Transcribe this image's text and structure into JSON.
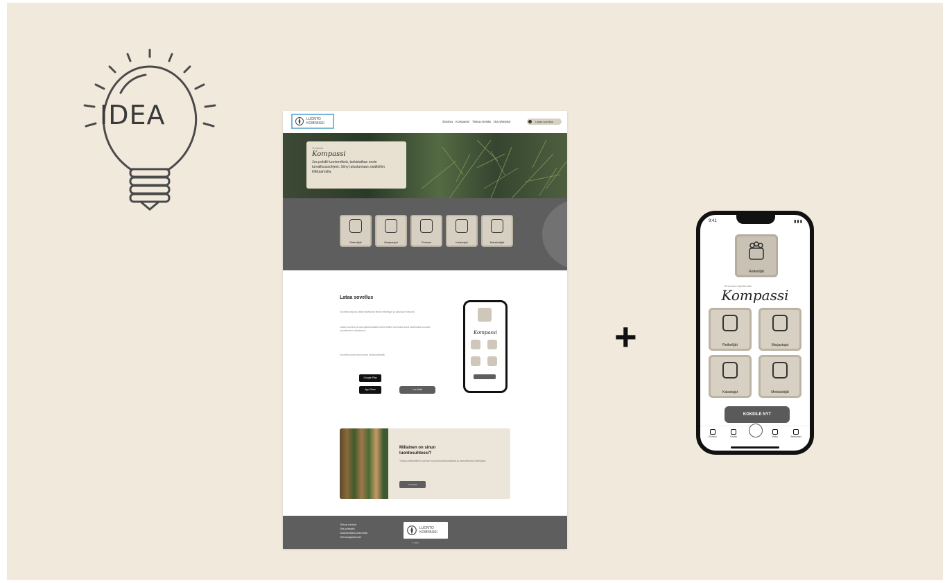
{
  "idea": {
    "label": "IDEA"
  },
  "website": {
    "logo_line1": "LUONTO",
    "logo_line2": "KOMPASSI",
    "nav_links": [
      "Etusivu",
      "Kompassi",
      "Tietoa meistä",
      "Ota yhteyttä"
    ],
    "nav_cta": "Lataa sovellus",
    "hero": {
      "kicker": "Tervetuloa",
      "title": "Kompassi",
      "text": "Jos pohdit luontoretkeä, tarkistathan ensin turvallisuusohjeet. Siirry tutustumaan sisältöihin klikkaamalla."
    },
    "tiles": [
      "Retkeilijät",
      "Marjastajat",
      "Perheet",
      "Kalastajat",
      "Metsästäjät"
    ],
    "mobile_section": {
      "title": "Lataa sovellus",
      "paragraphs": [
        "Sovellus tarjoaa kaikki tarvittavat tiedot retkeilyyn ja ulkoiluun helposti.",
        "Lataa sovellus ja saat ajankohtaiset tiedot reittien kunnosta sekä palveluista suoraan puhelimeesi maastossa.",
        "Sovellus toimii myös ilman verkkoyhteyttä."
      ],
      "store_google": "Google Play",
      "store_apple": "App Store",
      "button": "Lue lisää"
    },
    "forest": {
      "title": "Millainen on sinun luontosuhteesi?",
      "text": "Tutustu artikkeleihin luonnon hyvinvointivaikutuksista ja vastuullisesta retkeilystä.",
      "button": "Lue lisää"
    },
    "footer": {
      "links": [
        "Tietoa meistä",
        "Ota yhteyttä",
        "Saavutettavuusseloste",
        "Tietosuojaseloste"
      ],
      "logo_line1": "LUONTO",
      "logo_line2": "KOMPASSI",
      "copyright": "© 2024"
    }
  },
  "plus": "+",
  "phone": {
    "status_time": "9:41",
    "status_icons": "▮▮▮",
    "top_label": "Retkeilijät",
    "kicker": "Tervetuloa käyttämään",
    "title": "Kompassi",
    "tiles": [
      "Retkeilijät",
      "Marjastajat",
      "Kalastajat",
      "Metsästäjät"
    ],
    "button": "KOKEILE NYT",
    "tabs": [
      "Etusivu",
      "Kartta",
      "",
      "Haku",
      "Asetukset"
    ]
  }
}
